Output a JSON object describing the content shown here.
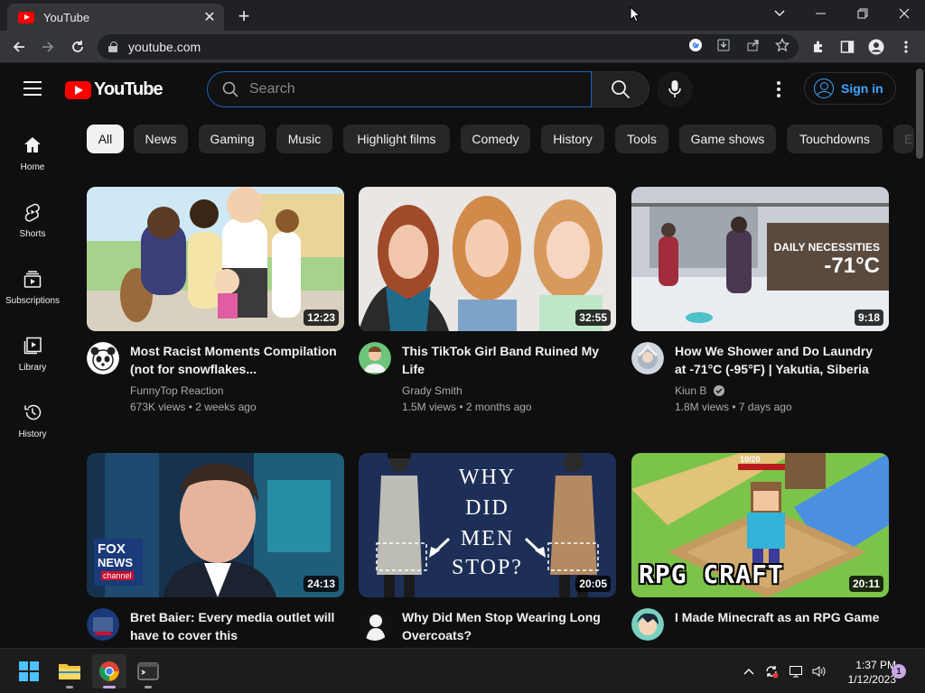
{
  "browser": {
    "tab_title": "YouTube",
    "url": "youtube.com"
  },
  "header": {
    "logo_text": "YouTube",
    "search_placeholder": "Search",
    "signin_label": "Sign in"
  },
  "sidebar": {
    "items": [
      {
        "label": "Home",
        "icon": "home-icon"
      },
      {
        "label": "Shorts",
        "icon": "shorts-icon"
      },
      {
        "label": "Subscriptions",
        "icon": "subscriptions-icon"
      },
      {
        "label": "Library",
        "icon": "library-icon"
      },
      {
        "label": "History",
        "icon": "history-icon"
      }
    ]
  },
  "chips": [
    "All",
    "News",
    "Gaming",
    "Music",
    "Highlight films",
    "Comedy",
    "History",
    "Tools",
    "Game shows",
    "Touchdowns",
    "E"
  ],
  "videos": [
    {
      "title": "Most Racist Moments Compilation (not for snowflakes...",
      "channel": "FunnyTop Reaction",
      "meta": "673K views • 2 weeks ago",
      "duration": "12:23",
      "verified": false
    },
    {
      "title": "This TikTok Girl Band Ruined My Life",
      "channel": "Grady Smith",
      "meta": "1.5M views • 2 months ago",
      "duration": "32:55",
      "verified": false
    },
    {
      "title": "How We Shower and Do Laundry at -71°C (-95°F) | Yakutia, Siberia",
      "channel": "Kiun B",
      "meta": "1.8M views • 7 days ago",
      "duration": "9:18",
      "verified": true,
      "thumb_text_1": "DAILY NECESSITIES",
      "thumb_text_2": "-71°C"
    },
    {
      "title": "Bret Baier: Every media outlet will have to cover this",
      "channel": "",
      "meta": "",
      "duration": "24:13",
      "verified": false,
      "thumb_text_1": "FOX",
      "thumb_text_2": "NEWS",
      "thumb_text_3": "channel"
    },
    {
      "title": "Why Did Men Stop Wearing Long Overcoats?",
      "channel": "",
      "meta": "",
      "duration": "20:05",
      "verified": false,
      "thumb_text_1": "WHY",
      "thumb_text_2": "DID",
      "thumb_text_3": "MEN",
      "thumb_text_4": "STOP?"
    },
    {
      "title": "I Made Minecraft as an RPG Game",
      "channel": "",
      "meta": "",
      "duration": "20:11",
      "verified": false,
      "thumb_text_1": "RPG CRAFT",
      "thumb_text_2": "10/20"
    }
  ],
  "taskbar": {
    "time": "1:37 PM",
    "date": "1/12/2023",
    "notifications": "1"
  },
  "colors": {
    "background": "#0f0f0f",
    "chip": "#272727",
    "chip_active": "#f1f1f1",
    "link_blue": "#3ea6ff",
    "youtube_red": "#ff0000"
  }
}
